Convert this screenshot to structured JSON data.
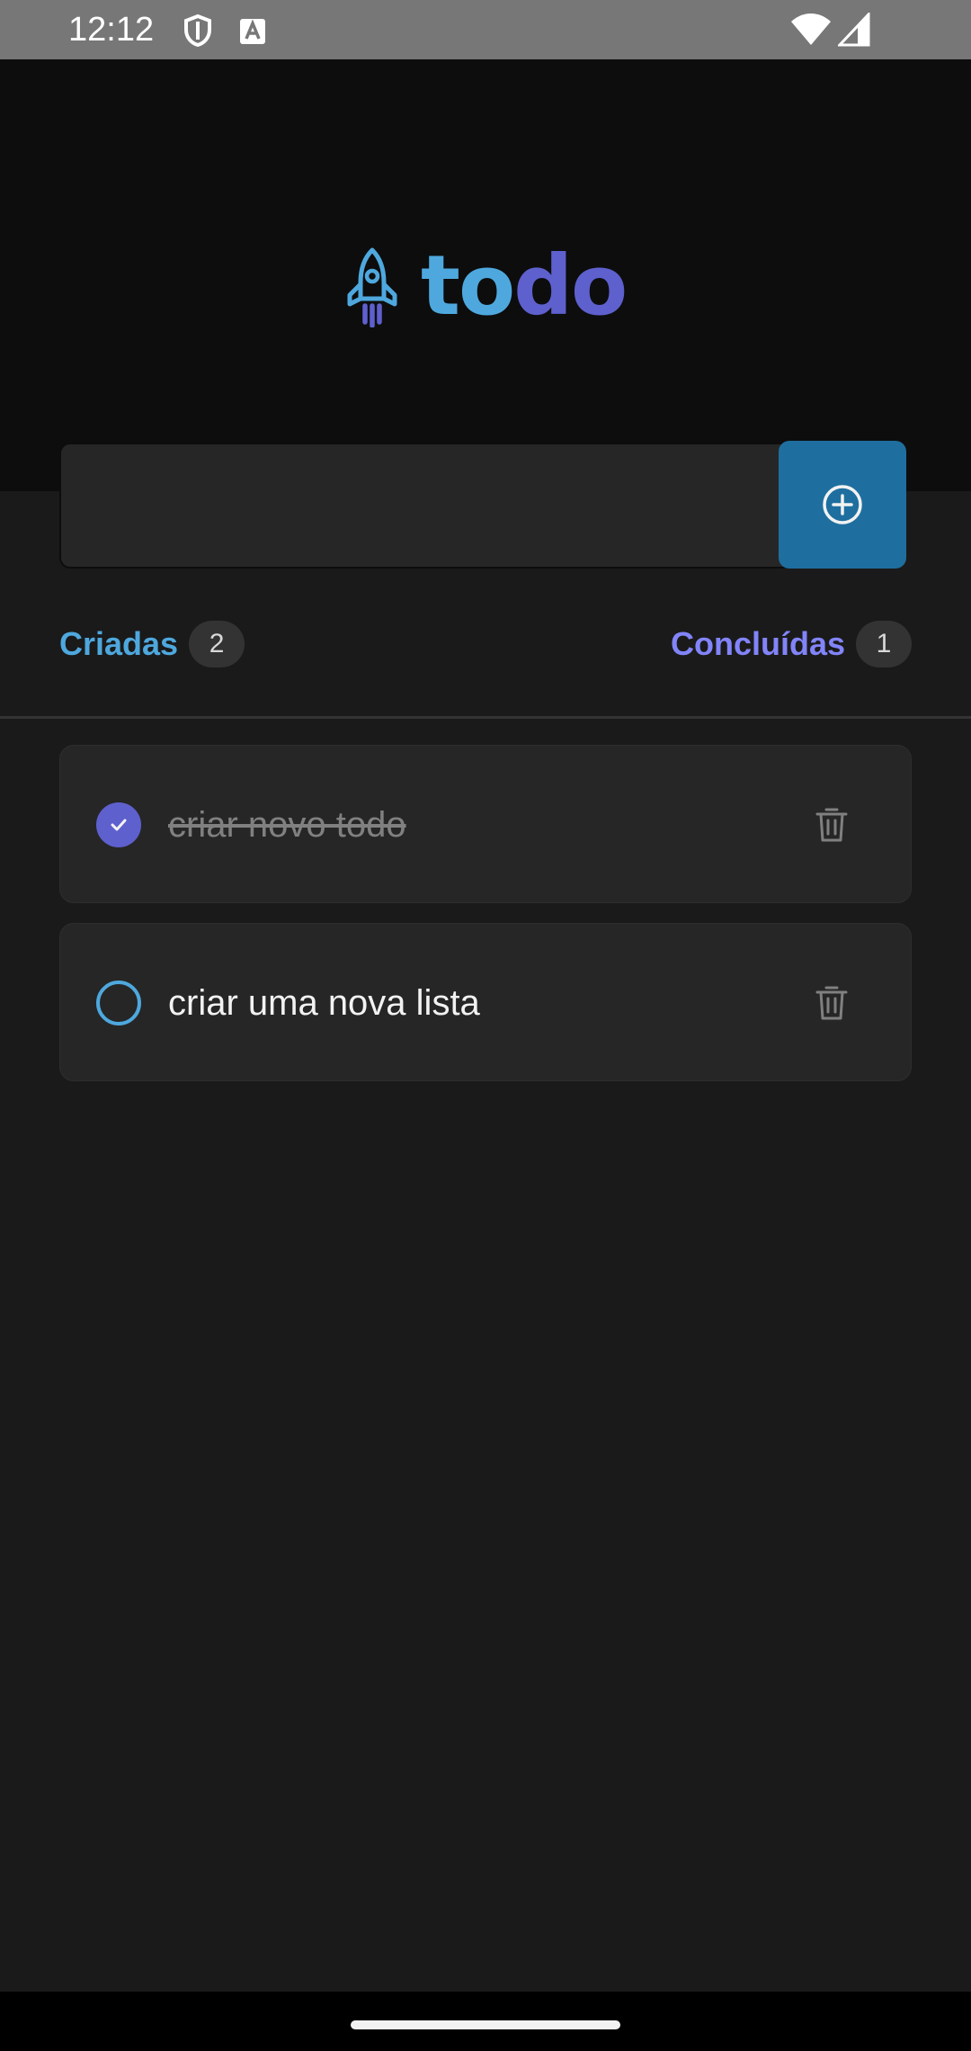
{
  "status_bar": {
    "time": "12:12",
    "icons": [
      "shield-icon",
      "a-notification-icon",
      "wifi-icon",
      "cellular-signal-icon"
    ]
  },
  "header": {
    "logo_icon": "rocket-icon",
    "logo_part1": "to",
    "logo_part2": "do"
  },
  "new_task": {
    "value": "",
    "placeholder": "",
    "add_icon": "plus-circle-icon"
  },
  "counters": {
    "created_label": "Criadas",
    "created_count": "2",
    "done_label": "Concluídas",
    "done_count": "1"
  },
  "tasks": [
    {
      "text": "criar novo todo",
      "completed": true,
      "delete_icon": "trash-icon"
    },
    {
      "text": "criar uma nova lista",
      "completed": false,
      "delete_icon": "trash-icon"
    }
  ],
  "colors": {
    "blue": "#4ea8de",
    "blue_dark": "#1e6f9f",
    "purple": "#5e60ce",
    "purple_light": "#8284fa",
    "header_bg": "#0d0d0d",
    "body_bg": "#1a1a1a",
    "card_bg": "#262626"
  }
}
